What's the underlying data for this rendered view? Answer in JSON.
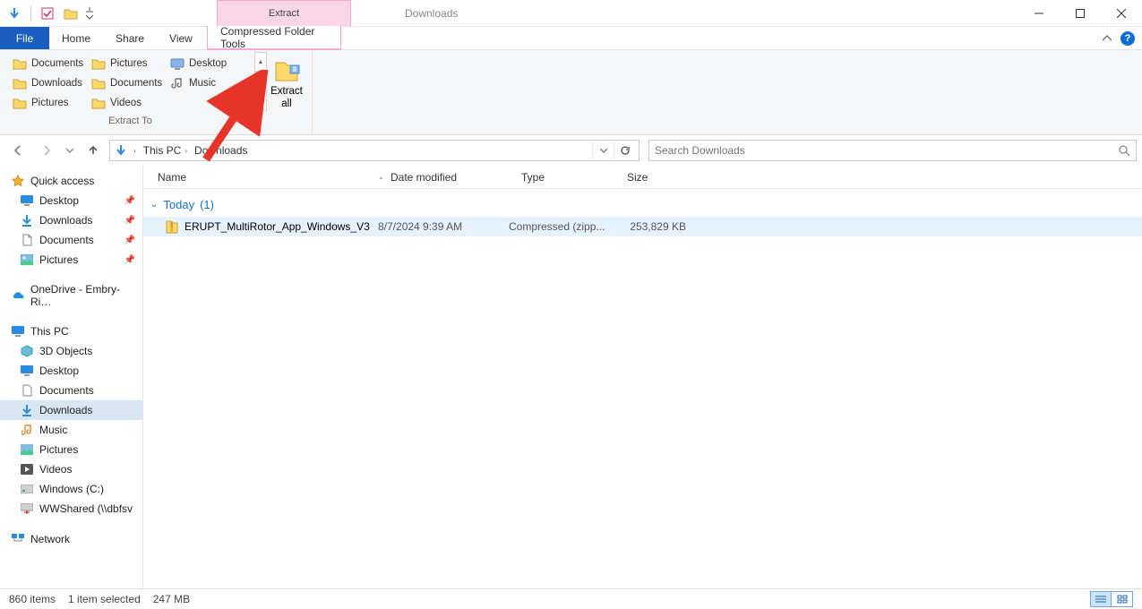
{
  "title": {
    "context_label": "Extract",
    "caption": "Downloads"
  },
  "tabs": {
    "file": "File",
    "home": "Home",
    "share": "Share",
    "view": "View",
    "ctx": "Compressed Folder Tools"
  },
  "ribbon": {
    "extract_to": {
      "items": [
        {
          "label": "Documents",
          "icon": "folder"
        },
        {
          "label": "Pictures",
          "icon": "folder"
        },
        {
          "label": "Desktop",
          "icon": "desktop"
        },
        {
          "label": "Downloads",
          "icon": "folder"
        },
        {
          "label": "Documents",
          "icon": "folder"
        },
        {
          "label": "Music",
          "icon": "music"
        },
        {
          "label": "Pictures",
          "icon": "folder"
        },
        {
          "label": "Videos",
          "icon": "folder"
        }
      ],
      "group_label": "Extract To"
    },
    "extract_all": {
      "line1": "Extract",
      "line2": "all"
    }
  },
  "address": {
    "segments": [
      "This PC",
      "Downloads"
    ]
  },
  "search": {
    "placeholder": "Search Downloads"
  },
  "nav_pane": {
    "quick_access": "Quick access",
    "qa_items": [
      {
        "label": "Desktop",
        "icon": "desktop-blue"
      },
      {
        "label": "Downloads",
        "icon": "download"
      },
      {
        "label": "Documents",
        "icon": "doc"
      },
      {
        "label": "Pictures",
        "icon": "picture"
      }
    ],
    "onedrive": "OneDrive - Embry-Ri…",
    "this_pc": "This PC",
    "pc_items": [
      {
        "label": "3D Objects",
        "icon": "cube"
      },
      {
        "label": "Desktop",
        "icon": "desktop-blue"
      },
      {
        "label": "Documents",
        "icon": "doc"
      },
      {
        "label": "Downloads",
        "icon": "download",
        "selected": true
      },
      {
        "label": "Music",
        "icon": "music"
      },
      {
        "label": "Pictures",
        "icon": "picture"
      },
      {
        "label": "Videos",
        "icon": "video"
      },
      {
        "label": "Windows (C:)",
        "icon": "drive"
      },
      {
        "label": "WWShared (\\\\dbfsv",
        "icon": "netdrive"
      }
    ],
    "network": "Network"
  },
  "columns": {
    "name": "Name",
    "date": "Date modified",
    "type": "Type",
    "size": "Size"
  },
  "group": {
    "label": "Today",
    "count": "(1)"
  },
  "files": [
    {
      "name": "ERUPT_MultiRotor_App_Windows_V3",
      "date": "8/7/2024 9:39 AM",
      "type": "Compressed (zipp...",
      "size": "253,829 KB"
    }
  ],
  "status": {
    "items": "860 items",
    "selected": "1 item selected",
    "size": "247 MB"
  }
}
